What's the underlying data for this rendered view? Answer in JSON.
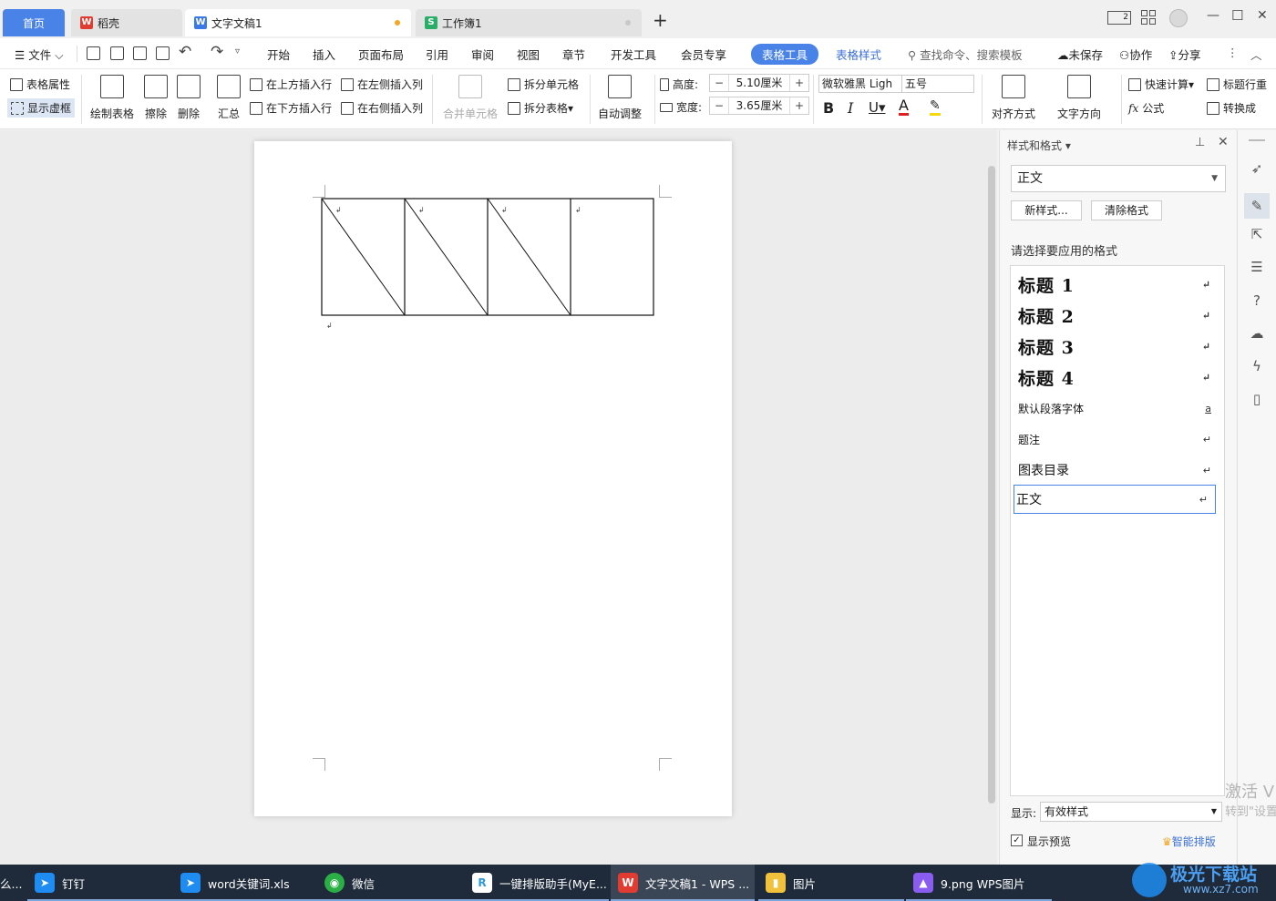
{
  "tabs": {
    "home": "首页",
    "daoke": "稻壳",
    "doc": "文字文稿1",
    "book": "工作簿1",
    "new_tab": "+"
  },
  "window_controls": {
    "layout_badge": "2",
    "minimize": "—",
    "maximize": "☐",
    "close": "✕"
  },
  "menu": {
    "file": "文件",
    "items": [
      "开始",
      "插入",
      "页面布局",
      "引用",
      "审阅",
      "视图",
      "章节",
      "开发工具",
      "会员专享"
    ],
    "active": "表格工具",
    "table_style": "表格样式",
    "search": "查找命令、搜索模板",
    "unsaved": "未保存",
    "collab": "协作",
    "share": "分享"
  },
  "ribbon": {
    "table_props": "表格属性",
    "show_gridlines": "显示虚框",
    "draw_table": "绘制表格",
    "erase": "擦除",
    "delete": "删除",
    "summary": "汇总",
    "insert_above": "在上方插入行",
    "insert_below": "在下方插入行",
    "insert_left": "在左侧插入列",
    "insert_right": "在右侧插入列",
    "merge_cells": "合并单元格",
    "split_cells": "拆分单元格",
    "split_table": "拆分表格",
    "auto_fit": "自动调整",
    "height_label": "高度:",
    "height_value": "5.10厘米",
    "width_label": "宽度:",
    "width_value": "3.65厘米",
    "font_name": "微软雅黑 Ligh",
    "font_size": "五号",
    "align": "对齐方式",
    "text_dir": "文字方向",
    "quick_calc": "快速计算",
    "header_repeat": "标题行重",
    "formula": "公式",
    "convert": "转换成"
  },
  "panel": {
    "title": "样式和格式",
    "current_style": "正文",
    "new_style": "新样式...",
    "clear_format": "清除格式",
    "prompt": "请选择要应用的格式",
    "styles": [
      {
        "label": "标题  1",
        "mark": "↵",
        "kind": "heading"
      },
      {
        "label": "标题  2",
        "mark": "↵",
        "kind": "heading"
      },
      {
        "label": "标题  3",
        "mark": "↵",
        "kind": "heading"
      },
      {
        "label": "标题  4",
        "mark": "↵",
        "kind": "heading"
      },
      {
        "label": "默认段落字体",
        "mark": "a",
        "kind": "small"
      },
      {
        "label": "题注",
        "mark": "↵",
        "kind": "small"
      },
      {
        "label": "图表目录",
        "mark": "↵",
        "kind": "normal"
      },
      {
        "label": "正文",
        "mark": "↵",
        "kind": "normal"
      }
    ],
    "show_label": "显示:",
    "show_value": "有效样式",
    "preview": "显示预览",
    "smart": "智能排版"
  },
  "watermark": {
    "line1": "激活 V",
    "line2": "转到\"设置"
  },
  "taskbar": [
    {
      "label": "钉钉",
      "icon_color": "#1e8cf0"
    },
    {
      "label": "word关键词.xls",
      "icon_color": "#1e8cf0"
    },
    {
      "label": "微信",
      "icon_color": "#2aae45"
    },
    {
      "label": "一键排版助手(MyE...",
      "icon_color": "#2c9bd8"
    },
    {
      "label": "文字文稿1 - WPS ...",
      "icon_color": "#e03c31"
    },
    {
      "label": "图片",
      "icon_color": "#f2c13b"
    },
    {
      "label": "9.png  WPS图片",
      "icon_color": "#8a5cf0"
    }
  ],
  "taskbar_left_stub": "么...",
  "brand_watermark": {
    "main": "极光下载站",
    "sub": "www.xz7.com"
  },
  "colors": {
    "accent": "#4a83e8",
    "doc_dot": "#f5a623",
    "font_color_red": "#e02020",
    "highlight": "#f5d90a"
  }
}
